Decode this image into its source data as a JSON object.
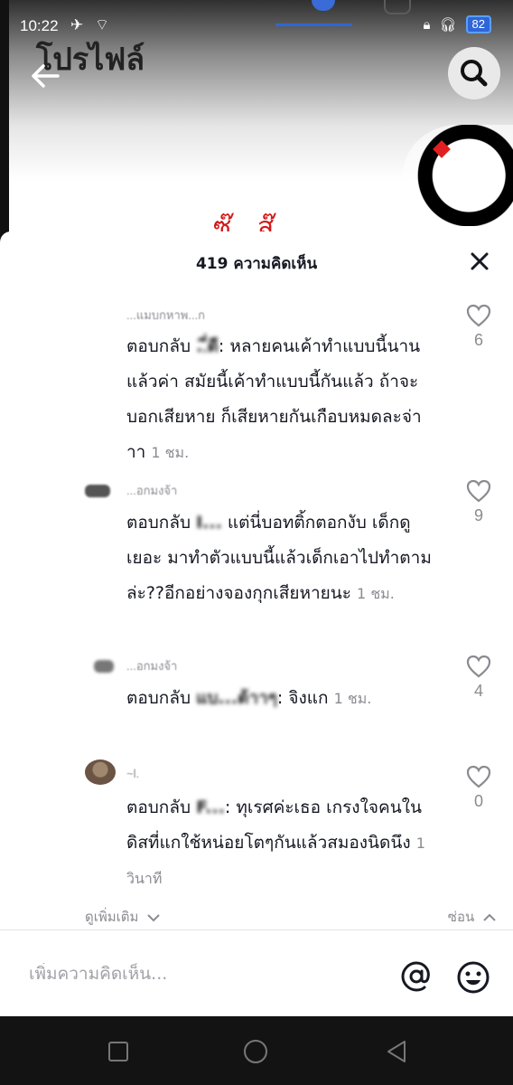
{
  "status_bar": {
    "time": "10:22",
    "battery": "82"
  },
  "background": {
    "title": "โปรไฟล์",
    "red_text": "ซ๊...ส๊"
  },
  "sheet": {
    "title": "419 ความคิดเห็น",
    "comments": [
      {
        "username": "...แมบกหาพ...ก",
        "reply_prefix": "ตอบกลับ",
        "mention": "..ี่ดี",
        "text": ": หลายคนเค้าทำแบบนี้นานแล้วค่า สมัยนี้เค้าทำแบบนี้กันแล้ว ถ้าจะบอกเสียหาย ก็เสียหายกันเกือบหมดละจ่าาา",
        "time": "1 ชม.",
        "likes": "6"
      },
      {
        "username": "...อกมงจ้า",
        "reply_prefix": "ตอบกลับ",
        "mention": "I...",
        "text": " แต่นี่บอทติ้กตอกงับ เด็กดูเยอะ มาทำตัวแบบนี้แล้วเด็กเอาไปทำตามล่ะ??อีกอย่างจองกุกเสียหายนะ",
        "time": "1 ชม.",
        "likes": "9"
      },
      {
        "username": "...อกมงจ้า",
        "reply_prefix": "ตอบกลับ",
        "mention": "แบ...ต้าาๆ",
        "text": ": จิงแก",
        "time": "1 ชม.",
        "likes": "4"
      },
      {
        "username": "~l.",
        "reply_prefix": "ตอบกลับ",
        "mention": "F...",
        "text": ": ทุเรศค่ะเธอ เกรงใจคนในดิสที่แกใช้หน่อยโตๆกันแล้วสมองนิดนึง",
        "time": "1 วินาที",
        "likes": "0"
      }
    ],
    "see_more": "ดูเพิ่มเติม",
    "hide": "ซ่อน"
  },
  "input": {
    "placeholder": "เพิ่มความคิดเห็น..."
  },
  "colors": {
    "accent": "#2f66d6",
    "text_primary": "#161823",
    "text_secondary": "#8a8b91"
  }
}
